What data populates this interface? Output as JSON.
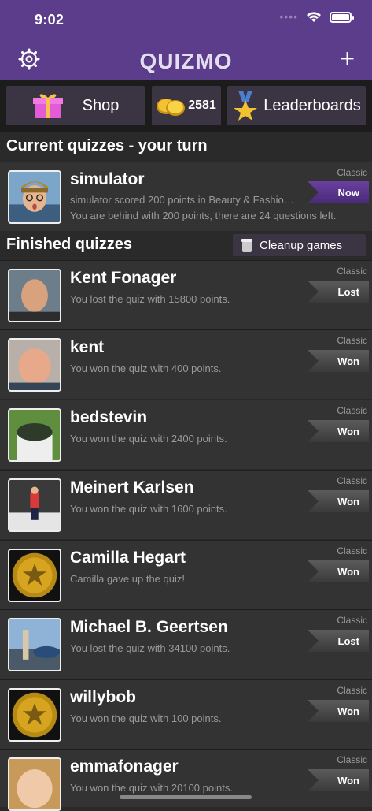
{
  "status": {
    "time": "9:02"
  },
  "nav": {
    "title": "QUIZMO",
    "add": "+"
  },
  "tabs": {
    "shop": "Shop",
    "coins": "2581",
    "leaderboards": "Leaderboards"
  },
  "sections": {
    "current": "Current quizzes - your turn",
    "finished": "Finished quizzes",
    "cleanup": "Cleanup games"
  },
  "current": [
    {
      "name": "simulator",
      "type": "Classic",
      "line1": "simulator scored 200 points in Beauty & Fashio…",
      "line2": "You are behind with 200 points, there are 24 questions left.",
      "badge": "Now"
    }
  ],
  "finished": [
    {
      "name": "Kent Fonager",
      "type": "Classic",
      "line": "You lost the quiz with 15800 points.",
      "badge": "Lost"
    },
    {
      "name": "kent",
      "type": "Classic",
      "line": "You won the quiz with 400 points.",
      "badge": "Won"
    },
    {
      "name": "bedstevin",
      "type": "Classic",
      "line": "You won the quiz with 2400 points.",
      "badge": "Won"
    },
    {
      "name": "Meinert Karlsen",
      "type": "Classic",
      "line": "You won the quiz with 1600 points.",
      "badge": "Won"
    },
    {
      "name": "Camilla Hegart",
      "type": "Classic",
      "line": "Camilla gave up the quiz!",
      "badge": "Won"
    },
    {
      "name": "Michael B. Geertsen",
      "type": "Classic",
      "line": "You lost the quiz with 34100 points.",
      "badge": "Lost"
    },
    {
      "name": "willybob",
      "type": "Classic",
      "line": "You won the quiz with 100 points.",
      "badge": "Won"
    },
    {
      "name": "emmafonager",
      "type": "Classic",
      "line": "You won the quiz with 20100 points.",
      "badge": "Won"
    }
  ]
}
